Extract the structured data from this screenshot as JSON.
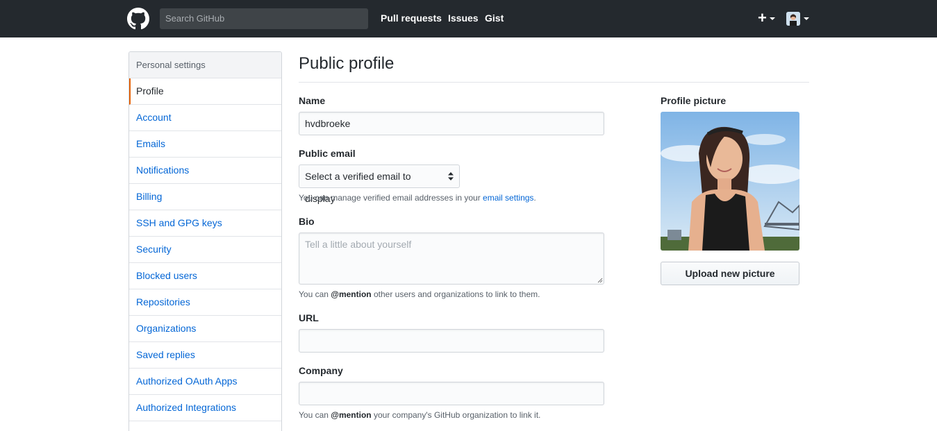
{
  "header": {
    "search_placeholder": "Search GitHub",
    "nav": [
      "Pull requests",
      "Issues",
      "Gist"
    ],
    "new_label": "+"
  },
  "sidebar": {
    "title": "Personal settings",
    "items": [
      {
        "label": "Profile"
      },
      {
        "label": "Account"
      },
      {
        "label": "Emails"
      },
      {
        "label": "Notifications"
      },
      {
        "label": "Billing"
      },
      {
        "label": "SSH and GPG keys"
      },
      {
        "label": "Security"
      },
      {
        "label": "Blocked users"
      },
      {
        "label": "Repositories"
      },
      {
        "label": "Organizations"
      },
      {
        "label": "Saved replies"
      },
      {
        "label": "Authorized OAuth Apps"
      },
      {
        "label": "Authorized Integrations"
      }
    ],
    "selected": "Profile"
  },
  "main": {
    "title": "Public profile",
    "name": {
      "label": "Name",
      "value": "hvdbroeke"
    },
    "public_email": {
      "label": "Public email",
      "selected": "Select a verified email to display",
      "note_prefix": "You can manage verified email addresses in your ",
      "note_link": "email settings",
      "note_suffix": "."
    },
    "bio": {
      "label": "Bio",
      "placeholder": "Tell a little about yourself",
      "note_prefix": "You can ",
      "note_bold": "@mention",
      "note_suffix": " other users and organizations to link to them."
    },
    "url": {
      "label": "URL",
      "value": ""
    },
    "company": {
      "label": "Company",
      "value": "",
      "note_prefix": "You can ",
      "note_bold": "@mention",
      "note_suffix": " your company's GitHub organization to link it."
    }
  },
  "profile_picture": {
    "label": "Profile picture",
    "upload_button": "Upload new picture"
  },
  "colors": {
    "header_bg": "#24292e",
    "link": "#0366d6",
    "selected_accent": "#e36209"
  }
}
